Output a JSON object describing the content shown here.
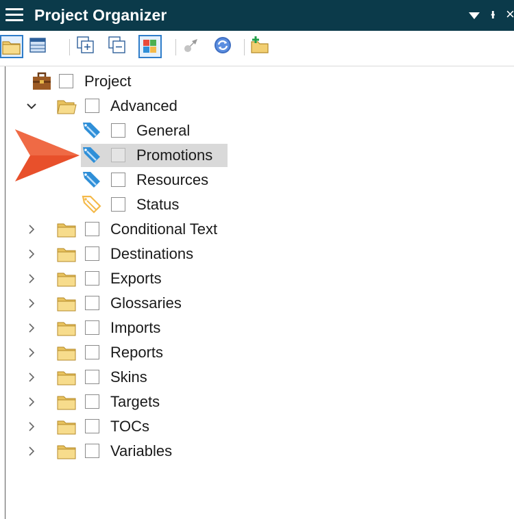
{
  "window": {
    "title": "Project Organizer",
    "menu_icon": "hamburger-icon",
    "dropdown_icon": "triangle-down-icon",
    "pin_icon": "pin-icon",
    "pin_glyph": "ᵼ",
    "close_icon": "close-icon",
    "close_glyph": "×"
  },
  "toolbar": {
    "buttons": [
      {
        "name": "show-folders-icon",
        "selected": true
      },
      {
        "name": "grid-view-icon",
        "selected": false
      },
      {
        "name": "expand-all-icon",
        "selected": false
      },
      {
        "name": "collapse-all-icon",
        "selected": false
      },
      {
        "name": "color-grid-icon",
        "selected": true
      },
      {
        "name": "build-icon",
        "selected": false,
        "disabled": true
      },
      {
        "name": "refresh-icon",
        "selected": false
      },
      {
        "name": "add-folder-icon",
        "selected": false
      }
    ]
  },
  "tree": {
    "root": {
      "label": "Project",
      "icon": "briefcase-icon"
    },
    "advanced": {
      "label": "Advanced",
      "expanded": true,
      "icon": "open-folder-icon",
      "children": [
        {
          "label": "General",
          "icon": "blue-tag-icon"
        },
        {
          "label": "Promotions",
          "icon": "blue-tag-icon",
          "highlighted": true
        },
        {
          "label": "Resources",
          "icon": "blue-tag-icon"
        },
        {
          "label": "Status",
          "icon": "orange-tag-icon"
        }
      ]
    },
    "folders": [
      {
        "label": "Conditional Text"
      },
      {
        "label": "Destinations"
      },
      {
        "label": "Exports"
      },
      {
        "label": "Glossaries"
      },
      {
        "label": "Imports"
      },
      {
        "label": "Reports"
      },
      {
        "label": "Skins"
      },
      {
        "label": "Targets"
      },
      {
        "label": "TOCs"
      },
      {
        "label": "Variables"
      }
    ]
  },
  "colors": {
    "titlebar": "#0b3a4a",
    "highlight": "#d9d9d9",
    "arrow": "#e8502b",
    "folder": "#f2cf72",
    "tag_blue": "#2f8fd8",
    "tag_orange": "#f4b94a"
  }
}
